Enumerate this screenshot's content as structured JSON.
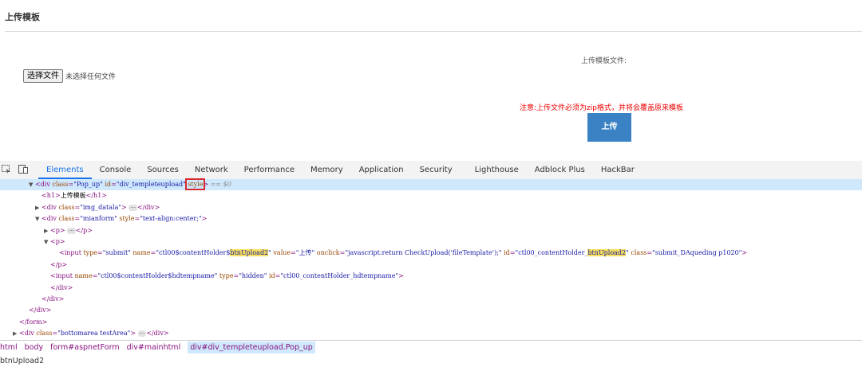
{
  "page": {
    "title": "上传模板",
    "upload_label": "上传模板文件:",
    "file_button": "选择文件",
    "file_status": "未选择任何文件",
    "notice": "注意:上传文件必须为zip格式，并将会覆盖原来模板",
    "submit": "上传"
  },
  "devtools": {
    "tabs": [
      "Elements",
      "Console",
      "Sources",
      "Network",
      "Performance",
      "Memory",
      "Application",
      "Security",
      "Lighthouse",
      "Adblock Plus",
      "HackBar"
    ],
    "active_tab": "Elements",
    "breadcrumbs": [
      "html",
      "body",
      "form#aspnetForm",
      "div#mainhtml",
      "div#div_templeteupload.Pop_up"
    ],
    "status": "btnUpload2",
    "dom": {
      "l1": {
        "tag": "div",
        "a1": "class",
        "v1": "\"Pop_up\"",
        "a2": "id",
        "v2": "\"div_templeteupload\"",
        "a3": "style",
        "eq": "==",
        "dollar": "$0"
      },
      "l2": {
        "open": "<h1>",
        "text": "上传模板",
        "close": "</h1>"
      },
      "l3": {
        "tag": "div",
        "a1": "class",
        "v1": "\"img_datala\"",
        "close": "</div>"
      },
      "l4": {
        "tag": "div",
        "a1": "class",
        "v1": "\"mianform\"",
        "a2": "style",
        "v2": "\"text-align:center;\""
      },
      "l5": {
        "open": "<p>",
        "close": "</p>"
      },
      "l6": {
        "open": "<p>"
      },
      "l7": {
        "a_type": "type",
        "v_type": "\"submit\"",
        "a_name": "name",
        "v_name_pre": "\"ctl00$contentHolder$",
        "hl1": "btnUpload2",
        "a_value": "value",
        "v_value": "\"上传\"",
        "a_onclick": "onclick",
        "v_onclick": "\"javascript:return CheckUpload('fileTemplate');\"",
        "a_id": "id",
        "v_id_pre": "\"ctl00_contentHolder_",
        "hl2": "btnUpload2",
        "a_class": "class",
        "v_class": "\"submit_DAqueding p1020\""
      },
      "l8": {
        "close": "</p>"
      },
      "l9": {
        "a_name": "name",
        "v_name": "\"ctl00$contentHolder$hdtempname\"",
        "a_type": "type",
        "v_type": "\"hidden\"",
        "a_id": "id",
        "v_id": "\"ctl00_contentHolder_hdtempname\""
      },
      "l10": {
        "close": "</div>"
      },
      "l11": {
        "close": "</div>"
      },
      "l12": {
        "close": "</div>"
      },
      "l13": {
        "close": "</form>"
      },
      "l14": {
        "tag": "div",
        "a1": "class",
        "v1": "\"bottomarea testArea\"",
        "close": "</div>"
      }
    }
  }
}
